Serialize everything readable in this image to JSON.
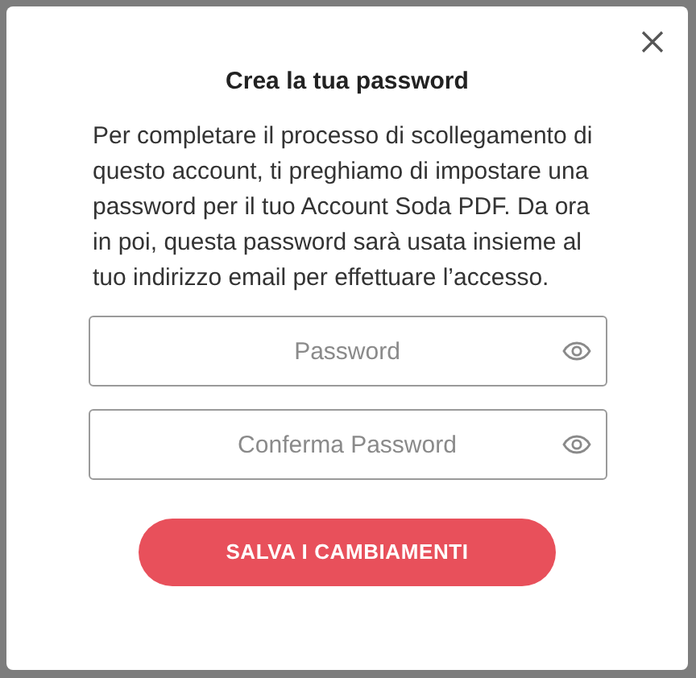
{
  "dialog": {
    "title": "Crea la tua password",
    "message": "Per completare il processo di scollegamento di questo account, ti preghiamo di impostare una password per il tuo Account Soda PDF. Da ora in poi, questa password sarà usata insieme al tuo indirizzo email per effettuare l’accesso.",
    "fields": [
      {
        "placeholder": "Password"
      },
      {
        "placeholder": "Conferma Password"
      }
    ],
    "button": "SALVA I CAMBIAMENTI"
  }
}
